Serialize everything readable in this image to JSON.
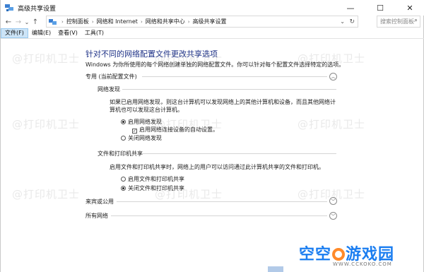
{
  "window": {
    "title": "高级共享设置",
    "minimize": "—",
    "maximize": "☐",
    "close": "✕"
  },
  "nav": {
    "back": "←",
    "forward": "→",
    "recent": "⌄",
    "up": "↑",
    "breadcrumbs": [
      "控制面板",
      "网络和 Internet",
      "网络和共享中心",
      "高级共享设置"
    ],
    "search_placeholder": "搜索控制面板"
  },
  "menu": {
    "items": [
      "文件(F)",
      "编辑(E)",
      "查看(V)",
      "工具(T)"
    ],
    "active_index": 0
  },
  "main": {
    "heading": "针对不同的网络配置文件更改共享选项",
    "description": "Windows 为你所使用的每个网络创建单独的网络配置文件。你可以针对每个配置文件选择特定的选项。",
    "private_profile": {
      "label": "专用 (当前配置文件)",
      "network_discovery": {
        "label": "网络发现",
        "text": "如果已启用网络发现，则这台计算机可以发现网络上的其他计算机和设备，而且其他网络计算机也可以发现这台计算机。",
        "option_on": "启用网络发现",
        "auto_setup": "启用网络连接设备的自动设置。",
        "option_off": "关闭网络发现",
        "selected": "on",
        "auto_setup_checked": true
      },
      "file_printer_sharing": {
        "label": "文件和打印机共享",
        "text": "启用文件和打印机共享时，网络上的用户可以访问通过此计算机共享的文件和打印机。",
        "option_on": "启用文件和打印机共享",
        "option_off": "关闭文件和打印机共享",
        "selected": "off"
      }
    },
    "guest_profile": {
      "label": "来宾或公用"
    },
    "all_networks": {
      "label": "所有网络"
    }
  },
  "watermark": {
    "text": "@打印机卫士"
  },
  "logo": {
    "text_left": "空空",
    "text_right": "游戏园",
    "sub": "WWW.CCKOKO.COM",
    "ring_color": "#ff8a2a",
    "text_color": "#1a7df0"
  },
  "colors": {
    "heading": "#1e3287",
    "menu_active_bg": "#cce4f7"
  }
}
